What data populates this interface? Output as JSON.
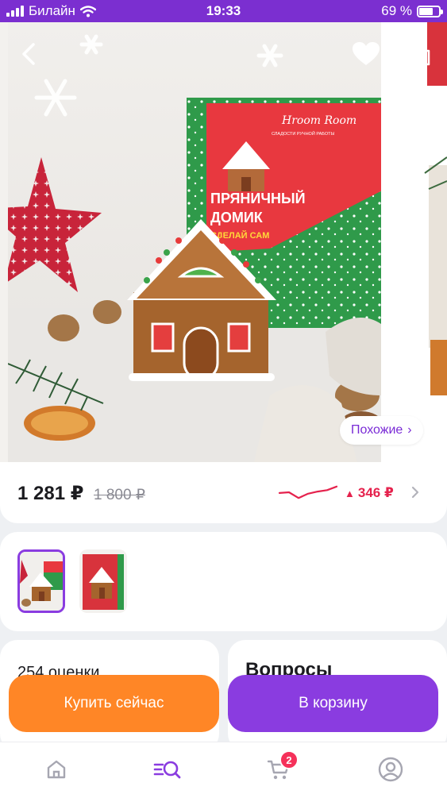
{
  "status_bar": {
    "carrier": "Билайн",
    "time": "19:33",
    "battery": "69 %",
    "battery_level": 0.69
  },
  "hero": {
    "similar_label": "Похожие",
    "similar_chevron": "›",
    "icons": {
      "back": "chevron-left-icon",
      "favorite": "heart-icon",
      "share": "share-icon"
    },
    "box_brand": "Hroom Room",
    "box_subtitle": "СЛАДОСТИ РУЧНОЙ РАБОТЫ",
    "box_title_line1": "ПРЯНИЧНЫЙ",
    "box_title_line2": "ДОМИК",
    "box_tagline": "СДЕЛАЙ САМ"
  },
  "price": {
    "current": "1 281 ₽",
    "old": "1 800 ₽",
    "diff": "346 ₽",
    "diff_arrow": "▲",
    "trend": [
      0.55,
      0.5,
      0.9,
      0.6,
      0.45,
      0.35,
      0.1
    ]
  },
  "reviews": {
    "count_label": "254 оценки"
  },
  "questions": {
    "title": "Вопросы"
  },
  "actions": {
    "buy_now": "Купить сейчас",
    "add_to_cart": "В корзину"
  },
  "tab_bar": {
    "cart_badge": "2",
    "items": [
      "home-icon",
      "catalog-search-icon",
      "cart-icon",
      "profile-icon"
    ]
  },
  "colors": {
    "brand_purple": "#8a3ce0",
    "status_purple": "#7b2fd0",
    "orange": "#ff8626",
    "price_red": "#e5224d"
  }
}
